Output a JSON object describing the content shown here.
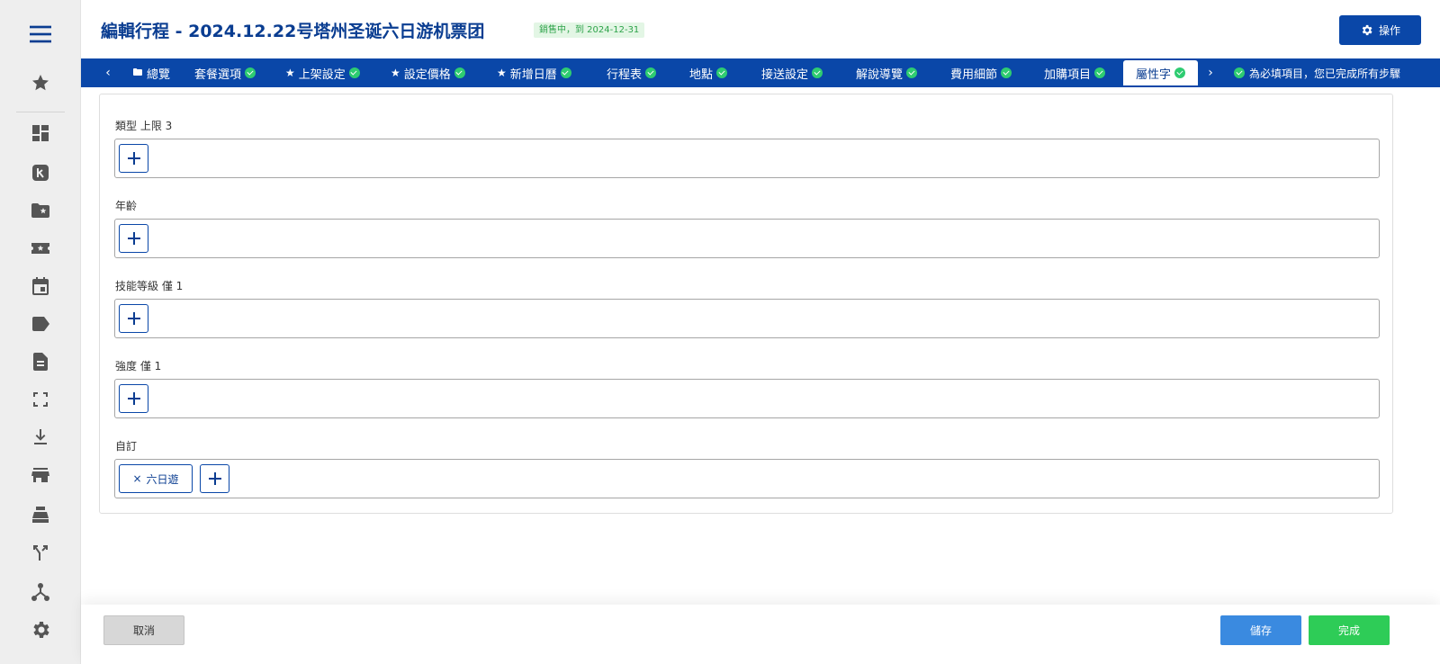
{
  "header": {
    "title": "編輯行程 - 2024.12.22号塔州圣诞六日游机票团",
    "status": "銷售中，到 2024-12-31",
    "action_label": "操作",
    "action_icon": "gear-icon"
  },
  "sidebar": {
    "items": [
      {
        "name": "menu-icon"
      },
      {
        "name": "star-icon"
      },
      {
        "name": "dashboard-icon"
      },
      {
        "name": "k-logo-icon"
      },
      {
        "name": "folder-star-icon"
      },
      {
        "name": "ticket-star-icon"
      },
      {
        "name": "calendar-icon"
      },
      {
        "name": "tag-icon"
      },
      {
        "name": "document-icon"
      },
      {
        "name": "fullscreen-icon"
      },
      {
        "name": "download-icon"
      },
      {
        "name": "store-icon"
      },
      {
        "name": "cash-register-icon"
      },
      {
        "name": "merge-icon"
      },
      {
        "name": "hierarchy-icon"
      },
      {
        "name": "settings-icon"
      }
    ]
  },
  "tabs": {
    "prev_arrow": "‹",
    "next_arrow": "›",
    "items": [
      {
        "label": "總覽",
        "icon": "folder-icon",
        "check": false
      },
      {
        "label": "套餐選項",
        "check": true
      },
      {
        "label": "上架設定",
        "icon": "star-icon",
        "check": true
      },
      {
        "label": "設定價格",
        "icon": "star-icon",
        "check": true
      },
      {
        "label": "新增日曆",
        "icon": "star-icon",
        "check": true
      },
      {
        "label": "行程表",
        "check": true
      },
      {
        "label": "地點",
        "check": true
      },
      {
        "label": "接送設定",
        "check": true
      },
      {
        "label": "解說導覽",
        "check": true
      },
      {
        "label": "費用細節",
        "check": true
      },
      {
        "label": "加購項目",
        "check": true
      },
      {
        "label": "屬性字",
        "check": true,
        "active": true
      }
    ],
    "note": "為必填項目，您已完成所有步驟"
  },
  "fields": [
    {
      "label": "類型 上限 3"
    },
    {
      "label": "年齡"
    },
    {
      "label": "技能等級 僅 1"
    },
    {
      "label": "強度 僅 1"
    },
    {
      "label": "自訂",
      "chips": [
        {
          "remove": "×",
          "text": "六日遊"
        }
      ]
    }
  ],
  "footer": {
    "cancel_label": "取消",
    "save_label": "儲存",
    "done_label": "完成"
  },
  "colors": {
    "brand": "#0a47a8",
    "check": "#2ecc71",
    "save": "#3a8ae0",
    "done": "#2ecc57"
  }
}
